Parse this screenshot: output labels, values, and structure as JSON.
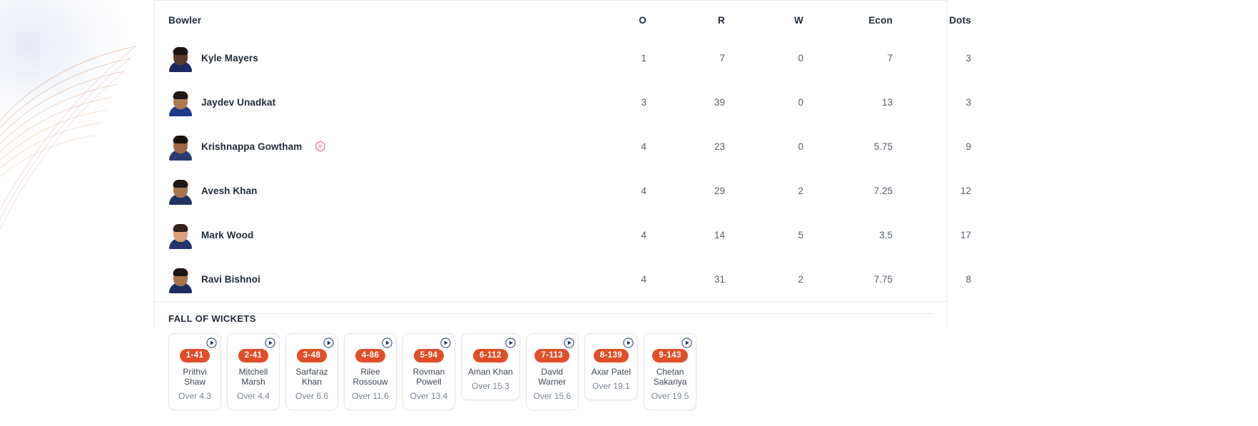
{
  "table": {
    "headers": {
      "bowler": "Bowler",
      "o": "O",
      "r": "R",
      "w": "W",
      "econ": "Econ",
      "dots": "Dots"
    },
    "rows": [
      {
        "name": "Kyle Mayers",
        "badge": "",
        "o": "1",
        "r": "7",
        "w": "0",
        "econ": "7",
        "dots": "3",
        "skin": "#5a3a28",
        "hair": "#1a1512",
        "jersey": "#1b2a5e"
      },
      {
        "name": "Jaydev Unadkat",
        "badge": "",
        "o": "3",
        "r": "39",
        "w": "0",
        "econ": "13",
        "dots": "3",
        "skin": "#b07a50",
        "hair": "#201914",
        "jersey": "#1e3a8a"
      },
      {
        "name": "Krishnappa Gowtham",
        "badge": "IP",
        "o": "4",
        "r": "23",
        "w": "0",
        "econ": "5.75",
        "dots": "9",
        "skin": "#9c6a44",
        "hair": "#191310",
        "jersey": "#2a3c6e"
      },
      {
        "name": "Avesh Khan",
        "badge": "",
        "o": "4",
        "r": "29",
        "w": "2",
        "econ": "7.25",
        "dots": "12",
        "skin": "#a9754c",
        "hair": "#1d1611",
        "jersey": "#1f3566"
      },
      {
        "name": "Mark Wood",
        "badge": "",
        "o": "4",
        "r": "14",
        "w": "5",
        "econ": "3.5",
        "dots": "17",
        "skin": "#d9a279",
        "hair": "#30221a",
        "jersey": "#23356b"
      },
      {
        "name": "Ravi Bishnoi",
        "badge": "",
        "o": "4",
        "r": "31",
        "w": "2",
        "econ": "7.75",
        "dots": "8",
        "skin": "#a9724a",
        "hair": "#1b1410",
        "jersey": "#1c2f63"
      }
    ]
  },
  "fall_of_wickets": {
    "title": "FALL OF WICKETS",
    "items": [
      {
        "score": "1-41",
        "batter": "Prithvi\nShaw",
        "over": "Over 4.3"
      },
      {
        "score": "2-41",
        "batter": "Mitchell\nMarsh",
        "over": "Over 4.4"
      },
      {
        "score": "3-48",
        "batter": "Sarfaraz\nKhan",
        "over": "Over 6.6"
      },
      {
        "score": "4-86",
        "batter": "Rilee\nRossouw",
        "over": "Over 11.6"
      },
      {
        "score": "5-94",
        "batter": "Rovman\nPowell",
        "over": "Over 13.4"
      },
      {
        "score": "6-112",
        "batter": "Aman Khan",
        "over": "Over 15.3"
      },
      {
        "score": "7-113",
        "batter": "David\nWarner",
        "over": "Over 15.6"
      },
      {
        "score": "8-139",
        "batter": "Axar Patel",
        "over": "Over 19.1"
      },
      {
        "score": "9-143",
        "batter": "Chetan\nSakariya",
        "over": "Over 19.5"
      }
    ]
  },
  "colors": {
    "accent_red": "#e04e2a",
    "badge_pink": "#e0508f",
    "text_dark": "#1f2a37",
    "text_muted": "#7b8594",
    "border": "#e9ecef"
  },
  "icons": {
    "play": "play-circle-icon",
    "impact_player": "impact-player-badge-icon"
  }
}
